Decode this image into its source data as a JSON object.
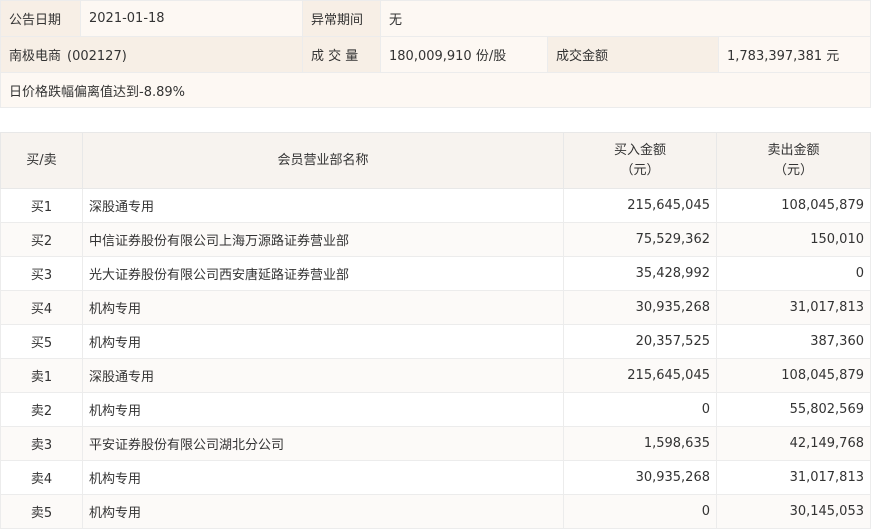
{
  "info": {
    "date_label": "公告日期",
    "date_value": "2021-01-18",
    "period_label": "异常期间",
    "period_value": "无",
    "stock_name": "南极电商",
    "stock_code": "(002127)",
    "volume_label": "成 交 量",
    "volume_value": "180,009,910 份/股",
    "turnover_label": "成交金额",
    "turnover_value": "1,783,397,381 元",
    "note": "日价格跌幅偏离值达到-8.89%"
  },
  "table": {
    "headers": {
      "type": "买/卖",
      "name": "会员营业部名称",
      "buy_line1": "买入金额",
      "buy_line2": "（元）",
      "sell_line1": "卖出金额",
      "sell_line2": "（元）"
    },
    "rows": [
      {
        "type": "买1",
        "name": "深股通专用",
        "buy": "215,645,045",
        "sell": "108,045,879"
      },
      {
        "type": "买2",
        "name": "中信证券股份有限公司上海万源路证券营业部",
        "buy": "75,529,362",
        "sell": "150,010"
      },
      {
        "type": "买3",
        "name": "光大证券股份有限公司西安唐延路证券营业部",
        "buy": "35,428,992",
        "sell": "0"
      },
      {
        "type": "买4",
        "name": "机构专用",
        "buy": "30,935,268",
        "sell": "31,017,813"
      },
      {
        "type": "买5",
        "name": "机构专用",
        "buy": "20,357,525",
        "sell": "387,360"
      },
      {
        "type": "卖1",
        "name": "深股通专用",
        "buy": "215,645,045",
        "sell": "108,045,879"
      },
      {
        "type": "卖2",
        "name": "机构专用",
        "buy": "0",
        "sell": "55,802,569"
      },
      {
        "type": "卖3",
        "name": "平安证券股份有限公司湖北分公司",
        "buy": "1,598,635",
        "sell": "42,149,768"
      },
      {
        "type": "卖4",
        "name": "机构专用",
        "buy": "30,935,268",
        "sell": "31,017,813"
      },
      {
        "type": "卖5",
        "name": "机构专用",
        "buy": "0",
        "sell": "30,145,053"
      }
    ]
  }
}
